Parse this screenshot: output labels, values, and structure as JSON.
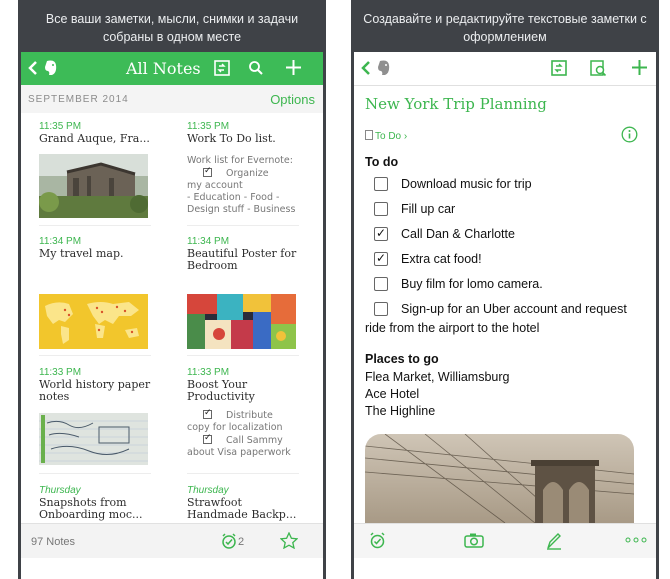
{
  "colors": {
    "accent": "#3db64f",
    "bar": "#3dbb57",
    "panel": "#3f4247"
  },
  "left": {
    "caption_line1": "Все ваши заметки, мысли, снимки и задачи",
    "caption_line2": "собраны в одном месте",
    "toolbar": {
      "title": "All Notes",
      "icons": [
        "back-icon",
        "elephant-icon",
        "sync-icon",
        "search-icon",
        "add-icon"
      ]
    },
    "section": {
      "date": "SEPTEMBER 2014",
      "options": "Options"
    },
    "notes": [
      {
        "time": "11:35 PM",
        "title": "Grand Auque, Fra..."
      },
      {
        "time": "11:35 PM",
        "title": "Work To Do list.",
        "body_line1": "Work list for Evernote:",
        "check1": "Organize",
        "body_line2": "my account",
        "body_line3": "- Education - Food -",
        "body_line4": "Design stuff - Business"
      },
      {
        "time": "11:34 PM",
        "title": "My travel map."
      },
      {
        "time": "11:34 PM",
        "title_line1": "Beautiful  Poster for",
        "title_line2": "Bedroom"
      },
      {
        "time": "11:33 PM",
        "title_line1": "World history paper",
        "title_line2": "notes"
      },
      {
        "time": "11:33 PM",
        "title_line1": "Boost Your",
        "title_line2": "Productivity",
        "check1": "Distribute",
        "body_line1": "copy for localization",
        "check2": "Call Sammy",
        "body_line2": "about Visa paperwork"
      },
      {
        "time": "Thursday",
        "title_line1": "Snapshots from",
        "title_line2": "Onboarding moc..."
      },
      {
        "time": "Thursday",
        "title_line1": "Strawfoot",
        "title_line2": "Handmade Backp..."
      }
    ],
    "bottom": {
      "count": "97 Notes",
      "reminders": "2"
    }
  },
  "right": {
    "caption_line1": "Создавайте и редактируйте текстовые заметки с",
    "caption_line2": "оформлением",
    "note_title": "New York Trip Planning",
    "notebook": "To Do",
    "todo_heading": "To do",
    "todos": [
      {
        "label": "Download music for trip",
        "checked": false
      },
      {
        "label": "Fill up car",
        "checked": false
      },
      {
        "label": "Call Dan & Charlotte",
        "checked": true
      },
      {
        "label": "Extra cat food!",
        "checked": true
      },
      {
        "label": "Buy film for lomo camera.",
        "checked": false
      },
      {
        "label": "Sign-up for an Uber account and request",
        "label2": "ride from the airport to the hotel",
        "checked": false
      }
    ],
    "places_heading": "Places to go",
    "places": [
      "Flea Market, Williamsburg",
      "Ace Hotel",
      "The Highline"
    ],
    "icons": [
      "reminder-icon",
      "camera-icon",
      "pen-icon",
      "more-icon"
    ]
  }
}
